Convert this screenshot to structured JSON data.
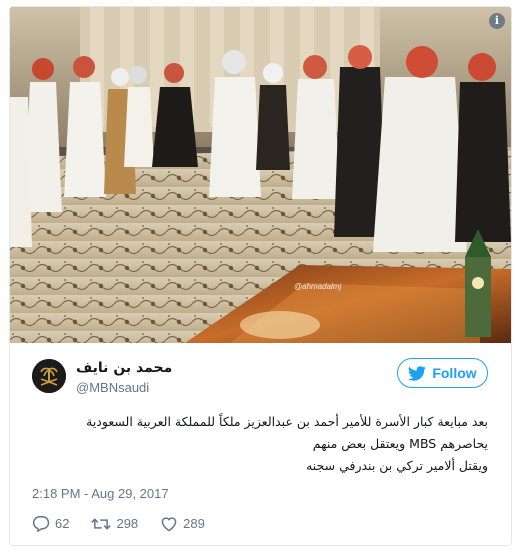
{
  "tweet": {
    "author_name": "محمد بن نايف",
    "author_handle": "@MBNsaudi",
    "follow_label": "Follow",
    "text_lines": [
      "بعد مبايعة كبار الأسرة للأمير أحمد بن عبدالعزيز ملكاً للمملكة العربية السعودية",
      "يحاصرهم MBS ويعتقل بعض منهم",
      "ويقتل ألامير تركي بن بندرفي سجنه"
    ],
    "timestamp": "2:18 PM - Aug 29, 2017",
    "reply_count": "62",
    "retweet_count": "298",
    "like_count": "289"
  },
  "photo": {
    "watermark": "@ahmadalmj",
    "info_badge": "i"
  },
  "colors": {
    "accent": "#1da1f2",
    "muted": "#657786",
    "border": "#e1e8ed"
  },
  "icons": [
    "info-icon",
    "twitter-bird-icon",
    "reply-icon",
    "retweet-icon",
    "like-icon"
  ]
}
